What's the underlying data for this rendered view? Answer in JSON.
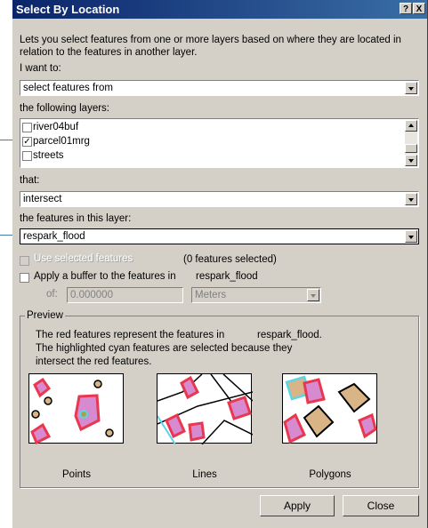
{
  "window": {
    "title": "Select By Location",
    "help_button": "?",
    "close_button": "X"
  },
  "intro": "Lets you select features from one or more layers based on where they are located in relation to the features in another layer.",
  "method": {
    "label": "I want to:",
    "value": "select features from"
  },
  "target_layers": {
    "label": "the following layers:",
    "items": [
      {
        "name": "river04buf",
        "checked": false
      },
      {
        "name": "parcel01mrg",
        "checked": true
      },
      {
        "name": "streets",
        "checked": false
      }
    ]
  },
  "relation": {
    "label": "that:",
    "value": "intersect"
  },
  "source_layer": {
    "label": "the features in this layer:",
    "value": "respark_flood"
  },
  "use_selected": {
    "label": "Use selected features",
    "checked": false,
    "enabled": false,
    "count_text": "(0 features selected)"
  },
  "buffer": {
    "label": "Apply a buffer to the features in",
    "layer": "respark_flood",
    "checked": false,
    "of_label": "of:",
    "distance": "0.000000",
    "units": "Meters"
  },
  "preview": {
    "group_label": "Preview",
    "description_line1_prefix": "The red features represent the features in",
    "description_line1_layer": "respark_flood.",
    "description_line2": "The highlighted cyan features are selected because they",
    "description_line3": "intersect the red features.",
    "captions": [
      "Points",
      "Lines",
      "Polygons"
    ]
  },
  "buttons": {
    "apply": "Apply",
    "close": "Close"
  },
  "colors": {
    "red": "#e8384f",
    "cyan": "#5ad6e6",
    "pink": "#d88ad0",
    "tan": "#d9b486",
    "olive": "#a8a24a"
  }
}
